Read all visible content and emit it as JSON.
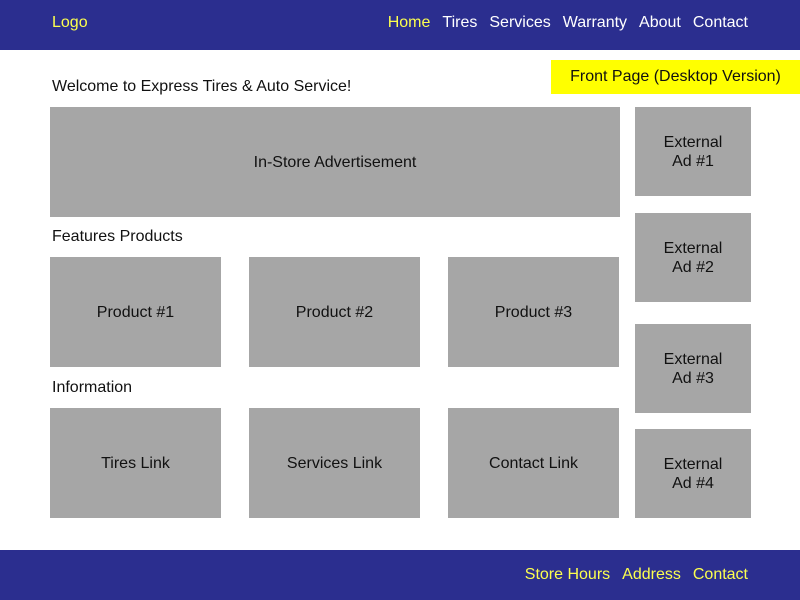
{
  "header": {
    "logo": "Logo",
    "nav": [
      "Home",
      "Tires",
      "Services",
      "Warranty",
      "About",
      "Contact"
    ],
    "active_nav": "Home"
  },
  "version_tag": "Front Page (Desktop Version)",
  "welcome": "Welcome to Express Tires & Auto Service!",
  "hero": {
    "label": "In-Store Advertisement"
  },
  "featured": {
    "heading": "Features Products",
    "items": [
      "Product #1",
      "Product #2",
      "Product #3"
    ]
  },
  "information": {
    "heading": "Information",
    "links": [
      "Tires Link",
      "Services Link",
      "Contact Link"
    ]
  },
  "external_ads": [
    {
      "line1": "External",
      "line2": "Ad #1"
    },
    {
      "line1": "External",
      "line2": "Ad #2"
    },
    {
      "line1": "External",
      "line2": "Ad #3"
    },
    {
      "line1": "External",
      "line2": "Ad #4"
    }
  ],
  "footer": {
    "links": [
      "Store Hours",
      "Address",
      "Contact"
    ]
  },
  "colors": {
    "header_bg": "#2b2e8f",
    "accent_yellow": "#fcff4f",
    "tag_yellow": "#ffff00",
    "placeholder_gray": "#a6a6a6"
  }
}
